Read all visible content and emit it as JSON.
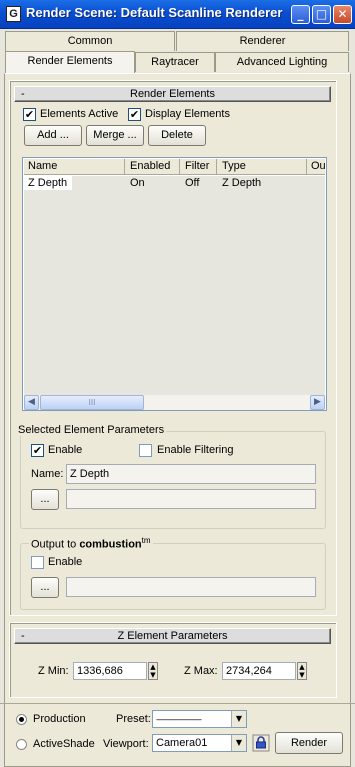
{
  "window": {
    "title": "Render Scene: Default Scanline Renderer",
    "minimize": "_",
    "maximize": "□",
    "close": "✕",
    "app_icon": "G"
  },
  "tabs": {
    "row1": [
      "Common",
      "Renderer"
    ],
    "row2": [
      "Render Elements",
      "Raytracer",
      "Advanced Lighting"
    ],
    "active": "Render Elements"
  },
  "render_elements": {
    "rollout_minus": "-",
    "rollout_title": "Render Elements",
    "elements_active": "Elements Active",
    "display_elements": "Display Elements",
    "add": "Add ...",
    "merge": "Merge ...",
    "delete": "Delete",
    "columns": [
      "Name",
      "Enabled",
      "Filter",
      "Type",
      "Ou"
    ],
    "rows": [
      [
        "Z Depth",
        "On",
        "Off",
        "Z Depth"
      ]
    ],
    "scroll_left": "◀",
    "scroll_right": "▶",
    "scroll_grip": "III"
  },
  "selected": {
    "group_title": "Selected Element Parameters",
    "enable": "Enable",
    "enable_filtering": "Enable Filtering",
    "name_label": "Name:",
    "name_value": "Z Depth",
    "browse": "..."
  },
  "combustion": {
    "title_prefix": "Output to ",
    "title_bold": "combustion",
    "tm": "tm",
    "enable": "Enable",
    "browse": "..."
  },
  "z_params": {
    "rollout_minus": "-",
    "rollout_title": "Z Element Parameters",
    "zmin_label": "Z Min:",
    "zmin_value": "1336,686",
    "zmax_label": "Z Max:",
    "zmax_value": "2734,264",
    "spin_up": "▲",
    "spin_down": "▼"
  },
  "bottom": {
    "production": "Production",
    "activeshade": "ActiveShade",
    "preset_label": "Preset:",
    "preset_value": "---------------------------",
    "viewport_label": "Viewport:",
    "viewport_value": "Camera01",
    "render": "Render",
    "dropdown_arrow": "▼"
  },
  "colors": {
    "titlebar": "#0a4fd1",
    "face": "#ece9d8",
    "list_bg": "#e6e5de"
  }
}
